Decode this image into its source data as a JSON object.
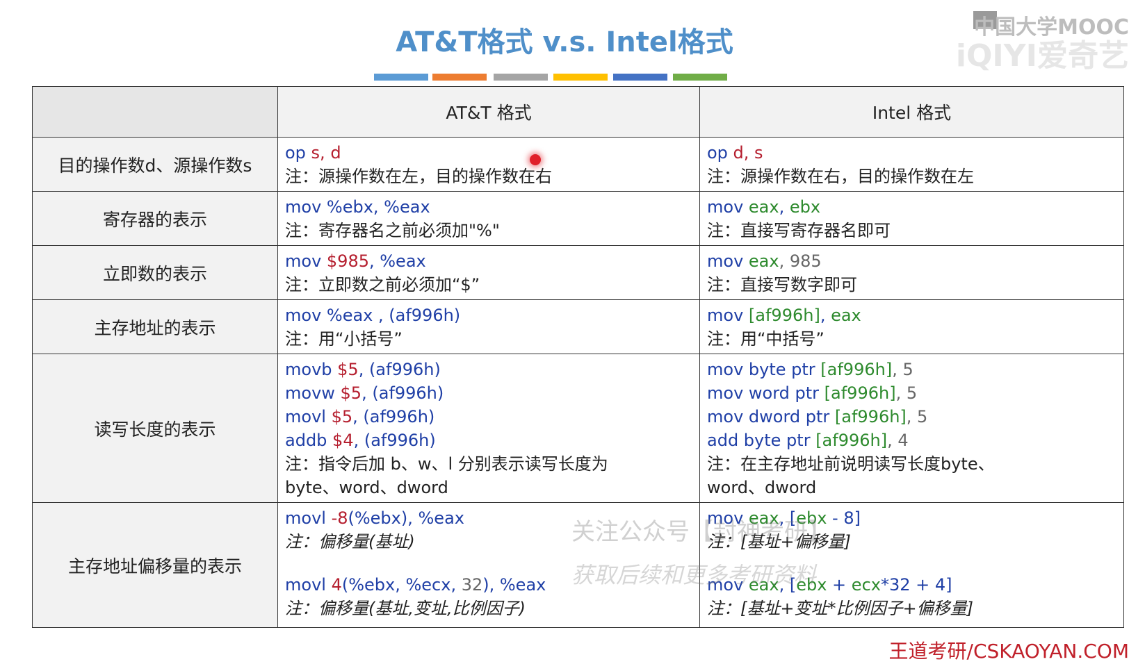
{
  "title": "AT&T格式 v.s. Intel格式",
  "color_bars": [
    "#5b9bd5",
    "#ed7d31",
    "#a5a5a5",
    "#ffc000",
    "#4472c4",
    "#70ad47"
  ],
  "logo": {
    "mooc": "中国大学MOOC",
    "iqiyi": "iQIYI爱奇艺"
  },
  "table": {
    "headers": {
      "col1": "",
      "col2": "AT&T 格式",
      "col3": "Intel 格式"
    },
    "rows": [
      {
        "label": "目的操作数d、源操作数s",
        "att": [
          [
            {
              "t": "op",
              "c": "blue"
            },
            {
              "t": " s, d",
              "c": "red"
            }
          ],
          [
            {
              "t": "注：源操作数在左，目的操作数在右",
              "c": "note"
            }
          ]
        ],
        "intel": [
          [
            {
              "t": "op",
              "c": "blue"
            },
            {
              "t": " d, s",
              "c": "red"
            }
          ],
          [
            {
              "t": "注：源操作数在右，目的操作数在左",
              "c": "note"
            }
          ]
        ]
      },
      {
        "label": "寄存器的表示",
        "att": [
          [
            {
              "t": "mov %ebx, %eax",
              "c": "blue"
            }
          ],
          [
            {
              "t": "注：寄存器名之前必须加\"%\"",
              "c": "note"
            }
          ]
        ],
        "intel": [
          [
            {
              "t": "mov ",
              "c": "blue"
            },
            {
              "t": "eax",
              "c": "green"
            },
            {
              "t": ", ",
              "c": "blue"
            },
            {
              "t": "ebx",
              "c": "green"
            }
          ],
          [
            {
              "t": "注：直接写寄存器名即可",
              "c": "note"
            }
          ]
        ]
      },
      {
        "label": "立即数的表示",
        "att": [
          [
            {
              "t": "mov ",
              "c": "blue"
            },
            {
              "t": "$985",
              "c": "red"
            },
            {
              "t": ", %eax",
              "c": "blue"
            }
          ],
          [
            {
              "t": "注：立即数之前必须加“$”",
              "c": "note"
            }
          ]
        ],
        "intel": [
          [
            {
              "t": "mov ",
              "c": "blue"
            },
            {
              "t": "eax",
              "c": "green"
            },
            {
              "t": ", 985",
              "c": "gray"
            }
          ],
          [
            {
              "t": "注：直接写数字即可",
              "c": "note"
            }
          ]
        ]
      },
      {
        "label": "主存地址的表示",
        "att": [
          [
            {
              "t": "mov %eax , (af996h)",
              "c": "blue"
            }
          ],
          [
            {
              "t": "注：用“小括号”",
              "c": "note"
            }
          ]
        ],
        "intel": [
          [
            {
              "t": "mov ",
              "c": "blue"
            },
            {
              "t": "[af996h]",
              "c": "green"
            },
            {
              "t": ", ",
              "c": "blue"
            },
            {
              "t": "eax",
              "c": "green"
            }
          ],
          [
            {
              "t": "注：用“中括号”",
              "c": "note"
            }
          ]
        ]
      },
      {
        "label": "读写长度的表示",
        "att": [
          [
            {
              "t": "movb ",
              "c": "blue"
            },
            {
              "t": "$5",
              "c": "red"
            },
            {
              "t": ", (af996h)",
              "c": "blue"
            }
          ],
          [
            {
              "t": "movw ",
              "c": "blue"
            },
            {
              "t": "$5",
              "c": "red"
            },
            {
              "t": ", (af996h)",
              "c": "blue"
            }
          ],
          [
            {
              "t": "movl ",
              "c": "blue"
            },
            {
              "t": "$5",
              "c": "red"
            },
            {
              "t": ", (af996h)",
              "c": "blue"
            }
          ],
          [
            {
              "t": "addb ",
              "c": "blue"
            },
            {
              "t": "$4",
              "c": "red"
            },
            {
              "t": ", (af996h)",
              "c": "blue"
            }
          ],
          [
            {
              "t": "注：指令后加 b、w、l 分别表示读写长度为",
              "c": "note"
            }
          ],
          [
            {
              "t": "byte、word、dword",
              "c": "note"
            }
          ]
        ],
        "intel": [
          [
            {
              "t": "mov byte ptr ",
              "c": "blue"
            },
            {
              "t": "[af996h]",
              "c": "green"
            },
            {
              "t": ", 5",
              "c": "gray"
            }
          ],
          [
            {
              "t": "mov word ptr ",
              "c": "blue"
            },
            {
              "t": "[af996h]",
              "c": "green"
            },
            {
              "t": ", 5",
              "c": "gray"
            }
          ],
          [
            {
              "t": "mov dword ptr ",
              "c": "blue"
            },
            {
              "t": "[af996h]",
              "c": "green"
            },
            {
              "t": ", 5",
              "c": "gray"
            }
          ],
          [
            {
              "t": "add byte ptr ",
              "c": "blue"
            },
            {
              "t": "[af996h]",
              "c": "green"
            },
            {
              "t": ", 4",
              "c": "gray"
            }
          ],
          [
            {
              "t": "注：在主存地址前说明读写长度byte、",
              "c": "note"
            }
          ],
          [
            {
              "t": "word、dword",
              "c": "note"
            }
          ]
        ]
      },
      {
        "label": "主存地址偏移量的表示",
        "att": [
          [
            {
              "t": "movl ",
              "c": "blue"
            },
            {
              "t": "-8",
              "c": "red"
            },
            {
              "t": "(%ebx), %eax",
              "c": "blue"
            }
          ],
          [
            {
              "t": "注：偏移量(基址)",
              "c": "note it"
            }
          ],
          "spacer",
          [
            {
              "t": "movl ",
              "c": "blue"
            },
            {
              "t": "4",
              "c": "red"
            },
            {
              "t": "(%ebx, %ecx, ",
              "c": "blue"
            },
            {
              "t": "32",
              "c": "gray"
            },
            {
              "t": "), %eax",
              "c": "blue"
            }
          ],
          [
            {
              "t": "注：偏移量(基址,变址,比例因子)",
              "c": "note it"
            }
          ]
        ],
        "intel": [
          [
            {
              "t": "mov ",
              "c": "blue"
            },
            {
              "t": "eax",
              "c": "green"
            },
            {
              "t": ", [",
              "c": "blue"
            },
            {
              "t": "ebx",
              "c": "green"
            },
            {
              "t": " - 8]",
              "c": "blue"
            }
          ],
          [
            {
              "t": "注：[基址+偏移量]",
              "c": "note it"
            }
          ],
          "spacer",
          [
            {
              "t": "mov ",
              "c": "blue"
            },
            {
              "t": "eax",
              "c": "green"
            },
            {
              "t": ", [",
              "c": "blue"
            },
            {
              "t": "ebx",
              "c": "green"
            },
            {
              "t": " + ",
              "c": "blue"
            },
            {
              "t": "ecx",
              "c": "green"
            },
            {
              "t": "*32 + 4]",
              "c": "blue"
            }
          ],
          [
            {
              "t": "注：[基址+变址*比例因子+偏移量]",
              "c": "note it"
            }
          ]
        ]
      }
    ]
  },
  "watermark": {
    "line1": "关注公众号【封神考研】",
    "line2": "获取后续和更多考研资料"
  },
  "footer": "王道考研/CSKAOYAN.COM"
}
